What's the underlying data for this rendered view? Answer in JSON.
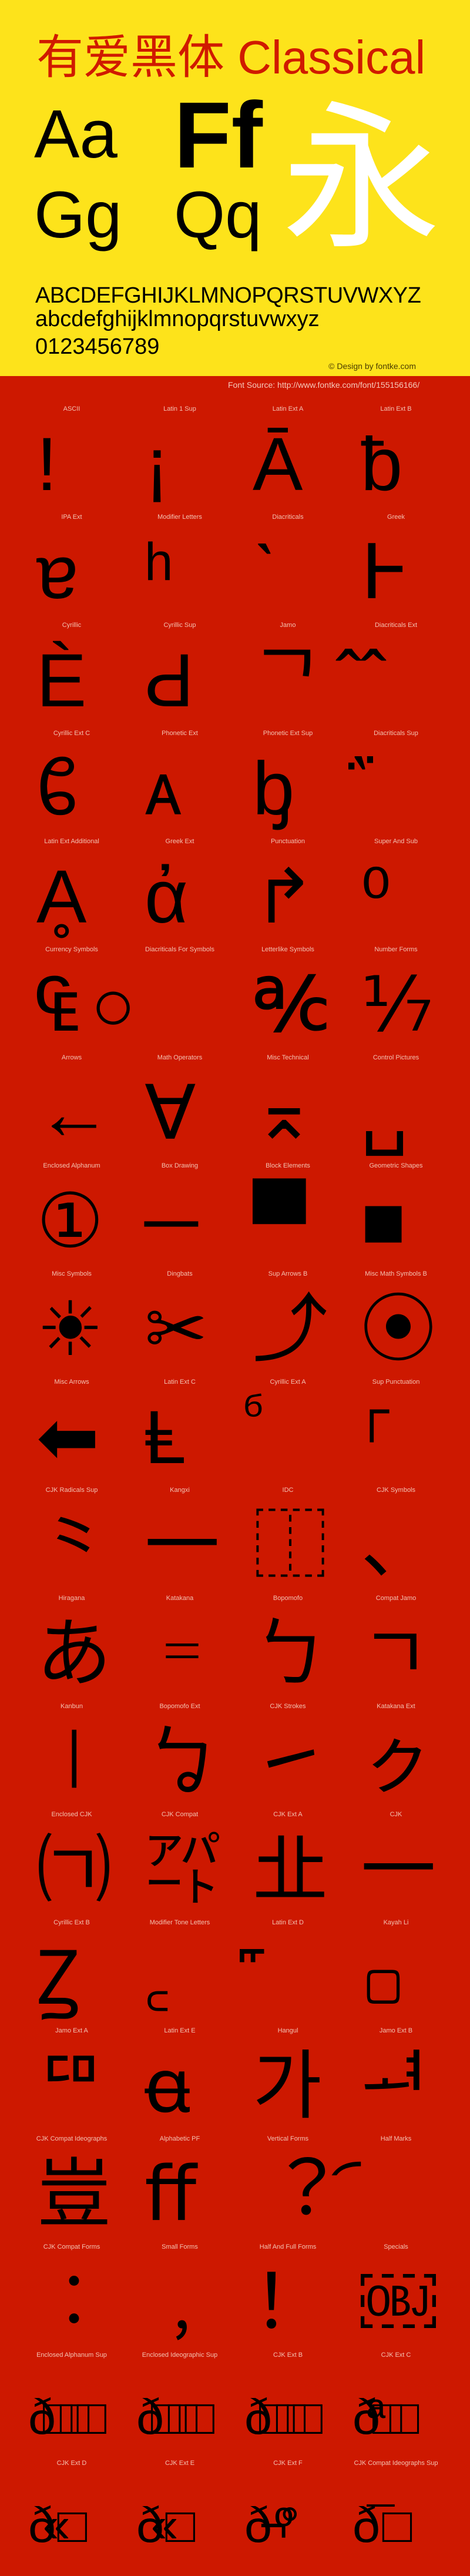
{
  "colors": {
    "header_bg": "#fde31b",
    "body_bg": "#cd1800",
    "title": "#d01a00",
    "glyph": "#000000",
    "label": "#f4c2b2"
  },
  "header": {
    "title": "有爱黑体 Classical",
    "specimen_pairs": [
      "Aa",
      "Ff",
      "Gg",
      "Qq"
    ],
    "hero_char": "永",
    "uppercase": "ABCDEFGHIJKLMNOPQRSTUVWXYZ",
    "lowercase": "abcdefghijklmnopqrstuvwxyz",
    "digits": "0123456789",
    "credit": "© Design by fontke.com"
  },
  "source": "Font Source: http://www.fontke.com/font/155156166/",
  "blocks": [
    {
      "label": "ASCII",
      "glyph": "!"
    },
    {
      "label": "Latin 1 Sup",
      "glyph": "¡"
    },
    {
      "label": "Latin Ext A",
      "glyph": "Ā"
    },
    {
      "label": "Latin Ext B",
      "glyph": "ƀ"
    },
    {
      "label": "IPA Ext",
      "glyph": "ɐ"
    },
    {
      "label": "Modifier Letters",
      "glyph": "ʰ"
    },
    {
      "label": "Diacriticals",
      "glyph": "ˋ"
    },
    {
      "label": "Greek",
      "glyph": "Ͱ"
    },
    {
      "label": "Cyrillic",
      "glyph": "Ѐ"
    },
    {
      "label": "Cyrillic Sup",
      "glyph": "Ԁ"
    },
    {
      "label": "Jamo",
      "glyph": "ᄀ"
    },
    {
      "label": "Diacriticals Ext",
      "glyph": "᪰"
    },
    {
      "label": "Cyrillic Ext C",
      "glyph": "ᲀ"
    },
    {
      "label": "Phonetic Ext",
      "glyph": "ᴀ"
    },
    {
      "label": "Phonetic Ext Sup",
      "glyph": "ᶀ"
    },
    {
      "label": "Diacriticals Sup",
      "glyph": "᷀"
    },
    {
      "label": "Latin Ext Additional",
      "glyph": "Ḁ"
    },
    {
      "label": "Greek Ext",
      "glyph": "ἀ"
    },
    {
      "label": "Punctuation",
      "glyph": "↱"
    },
    {
      "label": "Super And Sub",
      "glyph": "⁰"
    },
    {
      "label": "Currency Symbols",
      "glyph": "₠"
    },
    {
      "label": "Diacriticals For Symbols",
      "glyph": "○"
    },
    {
      "label": "Letterlike Symbols",
      "glyph": "℀"
    },
    {
      "label": "Number Forms",
      "glyph": "⅐"
    },
    {
      "label": "Arrows",
      "glyph": "←"
    },
    {
      "label": "Math Operators",
      "glyph": "∀"
    },
    {
      "label": "Misc Technical",
      "glyph": "⌅"
    },
    {
      "label": "Control Pictures",
      "glyph": "␣"
    },
    {
      "label": "Enclosed Alphanum",
      "glyph": "①"
    },
    {
      "label": "Box Drawing",
      "glyph": "─"
    },
    {
      "label": "Block Elements",
      "glyph": "▀"
    },
    {
      "label": "Geometric Shapes",
      "glyph": "■"
    },
    {
      "label": "Misc Symbols",
      "glyph": "☀"
    },
    {
      "label": "Dingbats",
      "glyph": "✂"
    },
    {
      "label": "Sup Arrows B",
      "glyph": "⤴"
    },
    {
      "label": "Misc Math Symbols B",
      "glyph": "⦿"
    },
    {
      "label": "Misc Arrows",
      "glyph": "⬅"
    },
    {
      "label": "Latin Ext C",
      "glyph": "Ⱡ"
    },
    {
      "label": "Cyrillic Ext A",
      "glyph": "ⷠ"
    },
    {
      "label": "Sup Punctuation",
      "glyph": "⸀"
    },
    {
      "label": "CJK Radicals Sup",
      "glyph": "⺀"
    },
    {
      "label": "Kangxi",
      "glyph": "⼀"
    },
    {
      "label": "IDC",
      "glyph": "⿰"
    },
    {
      "label": "CJK Symbols",
      "glyph": "、"
    },
    {
      "label": "Hiragana",
      "glyph": "あ"
    },
    {
      "label": "Katakana",
      "glyph": "゠"
    },
    {
      "label": "Bopomofo",
      "glyph": "ㄅ"
    },
    {
      "label": "Compat Jamo",
      "glyph": "ㄱ"
    },
    {
      "label": "Kanbun",
      "glyph": "㆐"
    },
    {
      "label": "Bopomofo Ext",
      "glyph": "ㆠ"
    },
    {
      "label": "CJK Strokes",
      "glyph": "㇀"
    },
    {
      "label": "Katakana Ext",
      "glyph": "ㇰ"
    },
    {
      "label": "Enclosed CJK",
      "glyph": "㈀"
    },
    {
      "label": "CJK Compat",
      "glyph": "㌀"
    },
    {
      "label": "CJK Ext A",
      "glyph": "㐀"
    },
    {
      "label": "CJK",
      "glyph": "一"
    },
    {
      "label": "Cyrillic Ext B",
      "glyph": "Ꙁ"
    },
    {
      "label": "Modifier Tone Letters",
      "glyph": "꜀"
    },
    {
      "label": "Latin Ext D",
      "glyph": "꜠"
    },
    {
      "label": "Kayah Li",
      "glyph": "꤀"
    },
    {
      "label": "Jamo Ext A",
      "glyph": "ꥠ"
    },
    {
      "label": "Latin Ext E",
      "glyph": "ꬰ"
    },
    {
      "label": "Hangul",
      "glyph": "가"
    },
    {
      "label": "Jamo Ext B",
      "glyph": "ힰ"
    },
    {
      "label": "CJK Compat Ideographs",
      "glyph": "豈"
    },
    {
      "label": "Alphabetic PF",
      "glyph": "ﬀ"
    },
    {
      "label": "Vertical Forms",
      "glyph": "︖"
    },
    {
      "label": "Half Marks",
      "glyph": "︠"
    },
    {
      "label": "CJK Compat Forms",
      "glyph": "︰"
    },
    {
      "label": "Small Forms",
      "glyph": "﹐"
    },
    {
      "label": "Half And Full Forms",
      "glyph": "！"
    },
    {
      "label": "Specials",
      "glyph": "￼"
    },
    {
      "label": "Enclosed Alphanum Sup",
      "glyph": "ð□□□"
    },
    {
      "label": "Enclosed Ideographic Sup",
      "glyph": "ð□□□"
    },
    {
      "label": "CJK Ext B",
      "glyph": "ð□□□"
    },
    {
      "label": "CJK Ext C",
      "glyph": "ðª□□"
    },
    {
      "label": "CJK Ext D",
      "glyph": "ð«□"
    },
    {
      "label": "CJK Ext E",
      "glyph": "ð«□"
    },
    {
      "label": "CJK Ext F",
      "glyph": "ð¬º°"
    },
    {
      "label": "CJK Compat Ideographs Sup",
      "glyph": "ð¯ □"
    }
  ]
}
